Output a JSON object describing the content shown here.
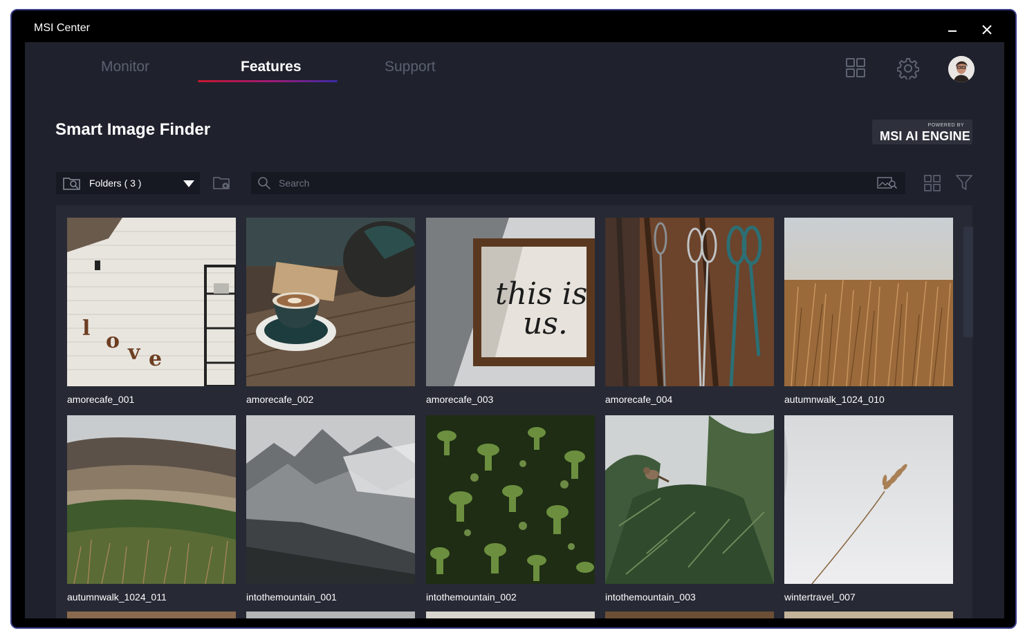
{
  "window": {
    "title": "MSI Center"
  },
  "nav": {
    "tabs": [
      {
        "label": "Monitor",
        "active": false
      },
      {
        "label": "Features",
        "active": true
      },
      {
        "label": "Support",
        "active": false
      }
    ]
  },
  "header_icons": [
    "apps-grid-icon",
    "gear-icon",
    "user-avatar"
  ],
  "page": {
    "title": "Smart Image Finder",
    "badge_small": "POWERED BY",
    "badge_big": "MSI AI ENGINE"
  },
  "toolbar": {
    "folder_select": "Folders ( 3 )",
    "search_placeholder": "Search"
  },
  "gallery": {
    "items": [
      {
        "name": "amorecafe_001",
        "icon": "love-brick-wall"
      },
      {
        "name": "amorecafe_002",
        "icon": "coffee-cup"
      },
      {
        "name": "amorecafe_003",
        "icon": "this-is-us-frame"
      },
      {
        "name": "amorecafe_004",
        "icon": "hanging-scissors"
      },
      {
        "name": "autumnwalk_1024_010",
        "icon": "golden-grass"
      },
      {
        "name": "autumnwalk_1024_011",
        "icon": "valley-landscape"
      },
      {
        "name": "intothemountain_001",
        "icon": "misty-mountains"
      },
      {
        "name": "intothemountain_002",
        "icon": "green-moss"
      },
      {
        "name": "intothemountain_003",
        "icon": "bird-on-pine"
      },
      {
        "name": "wintertravel_007",
        "icon": "winter-reed"
      }
    ]
  },
  "colors": {
    "app_bg": "#1f222d",
    "gallery_bg": "#272a35",
    "accent_red": "#c7172e",
    "accent_purple": "#3b2aa8"
  }
}
